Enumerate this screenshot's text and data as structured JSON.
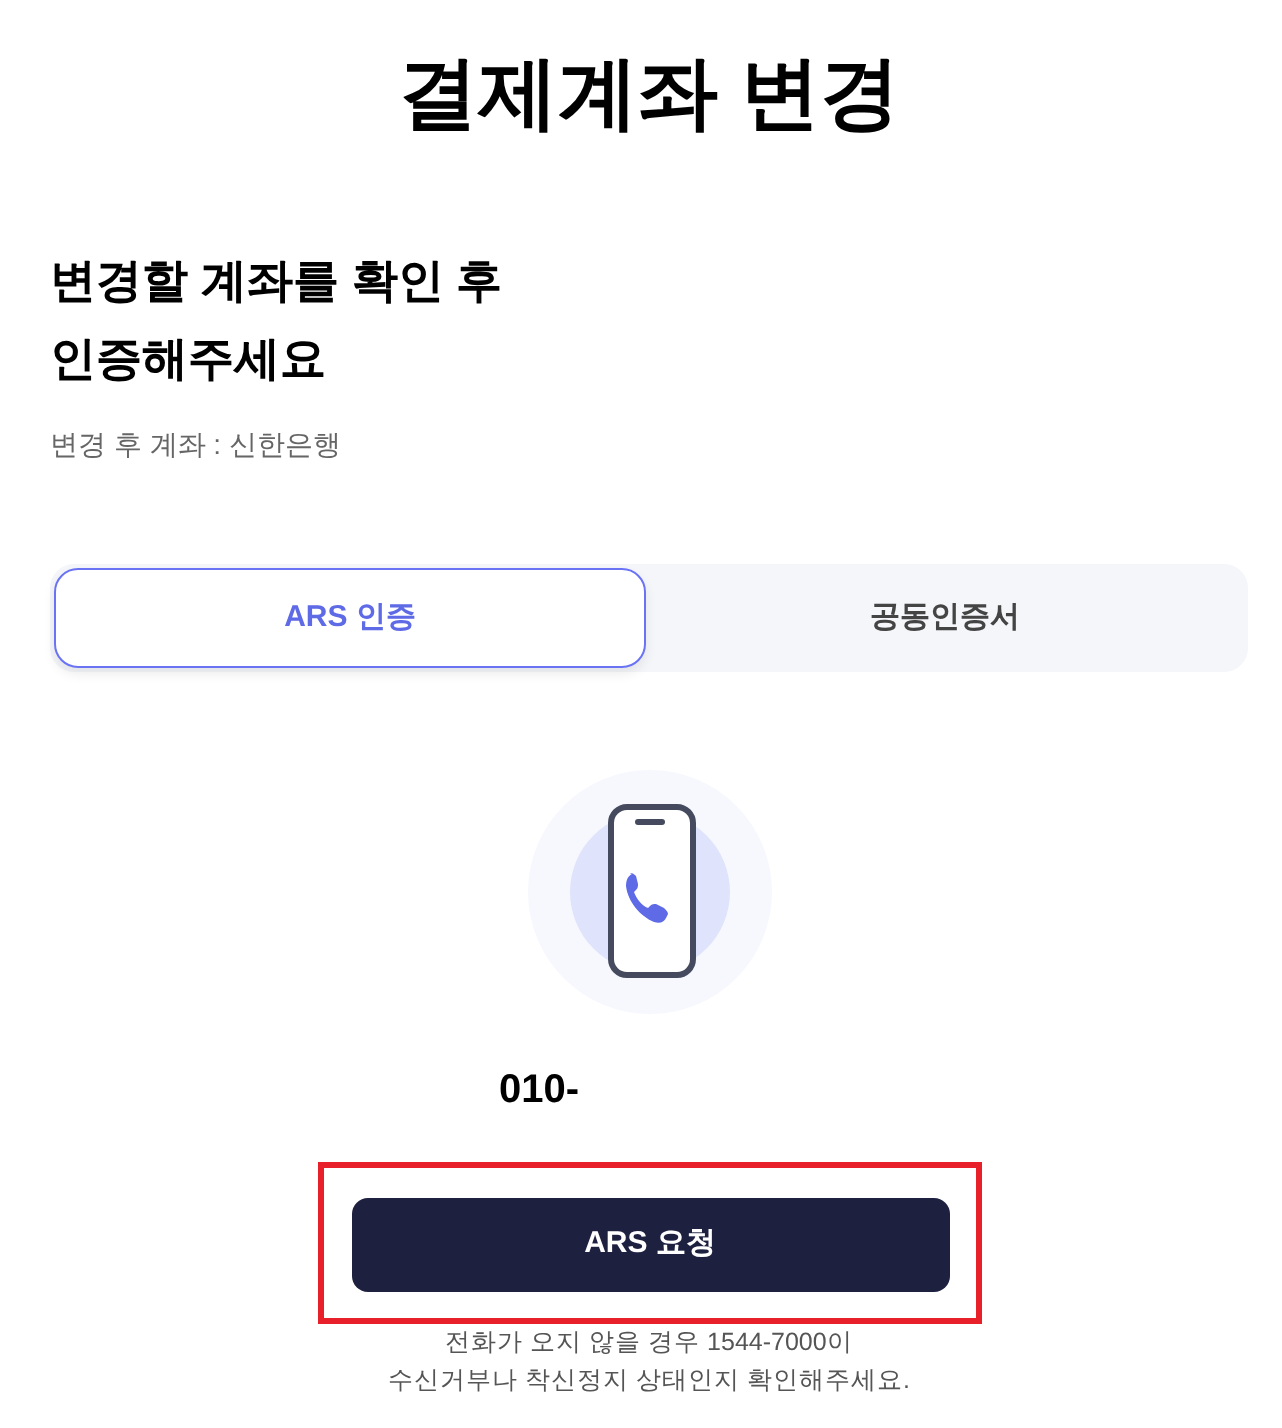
{
  "page": {
    "title": "결제계좌 변경"
  },
  "prompt": {
    "lines": [
      "변경할 계좌를 확인 후",
      "인증해주세요"
    ],
    "account_info": "변경 후 계좌 : 신한은행"
  },
  "tabs": [
    {
      "label": "ARS 인증",
      "selected": true
    },
    {
      "label": "공동인증서",
      "selected": false
    }
  ],
  "phone_number": "010-",
  "request_button": {
    "label": "ARS 요청",
    "highlighted": true
  },
  "notice_lines": [
    "전화가 오지 않을 경우 1544-7000이",
    "수신거부나 착신정지 상태인지 확인해주세요."
  ]
}
